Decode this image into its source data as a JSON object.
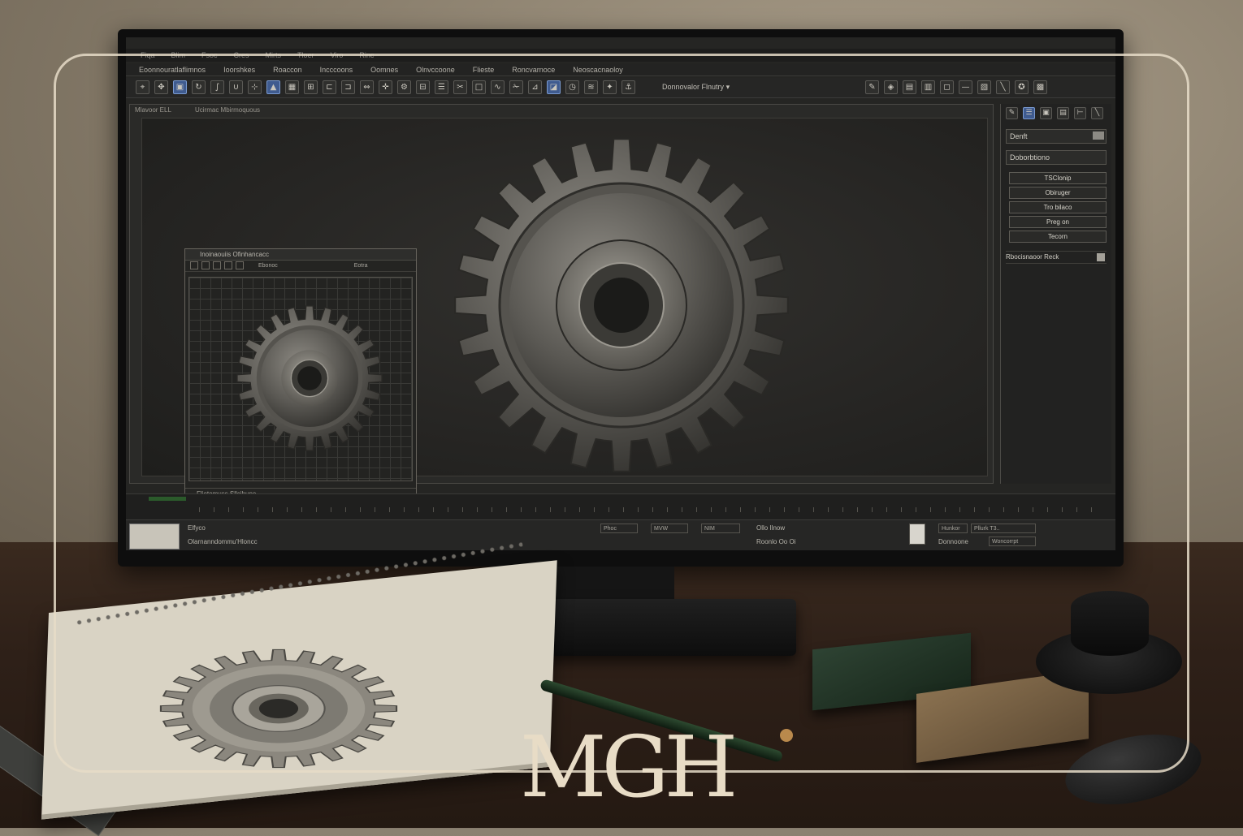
{
  "menubar": [
    "Fiqa",
    "Blim",
    "Fsoc",
    "Cres",
    "Mirts",
    "Tloer",
    "Viro",
    "Rinc"
  ],
  "tabs": [
    "Eoonnouratlaflimnos",
    "Ioorshkes",
    "Roaccon",
    "Incccoons",
    "Oomnes",
    "Olnvccoone",
    "Flieste",
    "Roncvarnoce",
    "Neoscacnaoloy"
  ],
  "toolbar": {
    "dropdown_label": "Donnovalor Flnutry"
  },
  "viewport": {
    "label": "Mlavoor ELL",
    "label2": "Ucirmac Mbirmoquous"
  },
  "subwindow": {
    "title": "Inoinaouiis Ofinhancacc",
    "dropdown": "Ebonoc",
    "corner_label": "Eotra",
    "status": "Fliotomuss Sllcihune"
  },
  "right_panel": {
    "field": "Denft",
    "field2": "Doborbtiono",
    "buttons": [
      "TSClonip",
      "Obiruger",
      "Tro bilaco",
      "Preg on",
      "Tecorn"
    ],
    "row_label": "Rbocisnaoor Reck"
  },
  "statusbar": {
    "text1": "Elfyco",
    "text2": "Olarnanndommu'Hloncc",
    "box1": "Phoc",
    "box2": "MVW",
    "box3": "NIM",
    "text3": "Ollo Ilnow",
    "text4": "Roonlo Oo Oi",
    "box4": "Hunkor",
    "box5": "Pllurk T3..",
    "text5": "Donnoone",
    "box6": "Woncorrpt"
  },
  "brand": {
    "logo_text": "MGH"
  }
}
